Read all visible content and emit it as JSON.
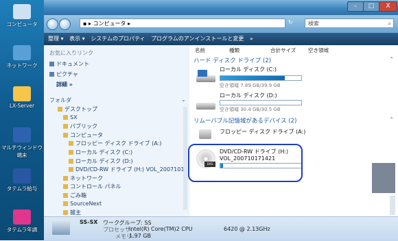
{
  "desktop": {
    "icons": [
      {
        "label": "コンピュータ",
        "color": "#cfe2f4"
      },
      {
        "label": "ネットワーク",
        "color": "#5aa0d6"
      },
      {
        "label": "LX-Server",
        "color": "#f5c64a"
      },
      {
        "label": "マルチウィンドウ端末",
        "color": "#2e62b0"
      },
      {
        "label": "タテムラ給与",
        "color": "#2a56a3"
      },
      {
        "label": "タテムラ年調",
        "color": "#e0368e"
      }
    ]
  },
  "window": {
    "address": "コンピュータ",
    "search_label": "検索",
    "buttons": {
      "min": "–",
      "max": "□",
      "close": "X"
    },
    "toolbar": [
      "整理",
      "表示",
      "システムのプロパティ",
      "プログラムのアンインストールと変更",
      "»"
    ]
  },
  "nav": {
    "favorites_label": "お気に入りリンク",
    "favorites": [
      "ドキュメント",
      "ピクチャ"
    ],
    "more": "詳細 »",
    "folder_label": "フォルダ",
    "tree": [
      {
        "label": "デスクトップ",
        "indent": 0
      },
      {
        "label": "SX",
        "indent": 1
      },
      {
        "label": "パブリック",
        "indent": 1
      },
      {
        "label": "コンピュータ",
        "indent": 1
      },
      {
        "label": "フロッピー ディスク ドライブ (A:)",
        "indent": 2
      },
      {
        "label": "ローカル ディスク (C:)",
        "indent": 2
      },
      {
        "label": "ローカル ディスク (D:)",
        "indent": 2
      },
      {
        "label": "DVD/CD-RW ドライブ (H:) VOL_20071017",
        "indent": 2
      },
      {
        "label": "ネットワーク",
        "indent": 1
      },
      {
        "label": "コントロール パネル",
        "indent": 1
      },
      {
        "label": "ごみ箱",
        "indent": 1
      },
      {
        "label": "SourceNext",
        "indent": 1
      },
      {
        "label": "雑主",
        "indent": 1
      }
    ]
  },
  "content": {
    "columns": [
      "名前",
      "種類",
      "合計サイズ",
      "空き領域"
    ],
    "group_hdd": "ハード ディスク ドライブ (2)",
    "group_removable": "リムーバブル記憶域があるデバイス (2)",
    "drives": [
      {
        "name": "ローカル ディスク (C:)",
        "free": "空き領域 7.89 GB/39.9 GB",
        "fill": 0.8
      },
      {
        "name": "ローカル ディスク (D:)",
        "free": "空き領域 30.4 GB/30.5 GB",
        "fill": 0.0
      },
      {
        "name": "フロッピー ディスク ドライブ (A:)",
        "free": "",
        "fill": null
      },
      {
        "name": "DVD/CD-RW ドライブ (H:)",
        "sub": "VOL_200710171421",
        "fill": 0.03
      }
    ]
  },
  "details": {
    "name": "SS-SX",
    "workgroup": "ワークグループ: SS",
    "processor_label": "プロセッサ:",
    "processor": "Intel(R) Core(TM)2 CPU",
    "processor_speed": "6420 @ 2.13GHz",
    "memory_label": "メモリ:",
    "memory": "1.97 GB"
  }
}
